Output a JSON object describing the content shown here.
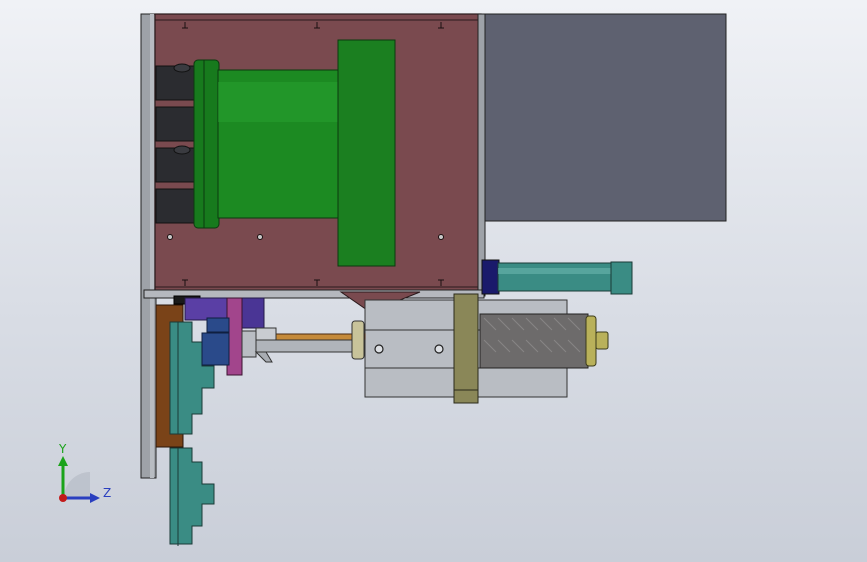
{
  "viewport": {
    "background_top": "#f0f2f6",
    "background_bottom": "#c9ced8"
  },
  "colors": {
    "housing_red": "#7a4a4f",
    "housing_edge": "#3b2a2c",
    "motor_slate": "#5e6170",
    "cylinder_green": "#1c8a22",
    "flange_green": "#177a1d",
    "teal_part": "#3a8c84",
    "steel_gray": "#b9bdc3",
    "bronze_block": "#8a8758",
    "brown_plate": "#7a4318",
    "blue_block": "#2a4a8a",
    "purple_block": "#5a3fa5",
    "magenta_bar": "#a2458c",
    "knurled_gray": "#6d6b6b",
    "brass_tip": "#b9b15a",
    "frame_gray": "#9ea2a8",
    "axis_y": "#1aa31a",
    "axis_z": "#2a3fbf",
    "axis_origin": "#c21a1a"
  },
  "triad": {
    "y_label": "Y",
    "z_label": "Z"
  }
}
